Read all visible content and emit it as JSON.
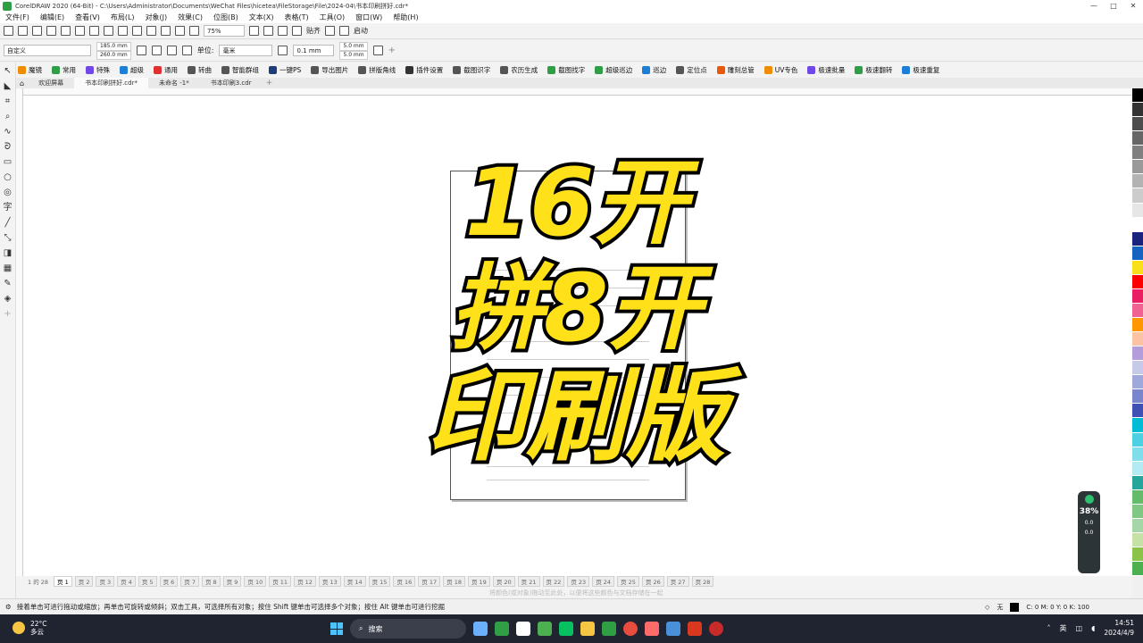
{
  "app": {
    "title": "CorelDRAW 2020 (64-Bit) - C:\\Users\\Administrator\\Documents\\WeChat Files\\hicetea\\FileStorage\\File\\2024-04\\书本印刷拼好.cdr*",
    "window_controls": [
      "—",
      "□",
      "✕"
    ]
  },
  "menu": [
    "文件(F)",
    "编辑(E)",
    "查看(V)",
    "布局(L)",
    "对象(J)",
    "效果(C)",
    "位图(B)",
    "文本(X)",
    "表格(T)",
    "工具(O)",
    "窗口(W)",
    "帮助(H)"
  ],
  "toolbar1": {
    "zoom": "75%",
    "snap_label": "贴齐",
    "launch_label": "启动"
  },
  "toolbar2": {
    "preset": "自定义",
    "width": "185.0 mm",
    "height": "260.0 mm",
    "units_label": "单位:",
    "units": "毫米",
    "nudge": "0.1 mm",
    "dup_x": "5.0 mm",
    "dup_y": "5.0 mm"
  },
  "plugins": [
    {
      "label": "魔镜",
      "color": "#f08c00"
    },
    {
      "label": "常用",
      "color": "#2f9e44"
    },
    {
      "label": "特殊",
      "color": "#7048e8"
    },
    {
      "label": "超级",
      "color": "#1c7ed6"
    },
    {
      "label": "通用",
      "color": "#e03131"
    },
    {
      "label": "转曲",
      "color": "#555555"
    },
    {
      "label": "智能群组",
      "color": "#555555"
    },
    {
      "label": "一键PS",
      "color": "#1c3d7a"
    },
    {
      "label": "导出图片",
      "color": "#555555"
    },
    {
      "label": "拼版角线",
      "color": "#555555"
    },
    {
      "label": "插件设置",
      "color": "#333333"
    },
    {
      "label": "截图识字",
      "color": "#555555"
    },
    {
      "label": "农历生成",
      "color": "#555555"
    },
    {
      "label": "截图找字",
      "color": "#2f9e44"
    },
    {
      "label": "超级巡边",
      "color": "#2f9e44"
    },
    {
      "label": "巡边",
      "color": "#1c7ed6"
    },
    {
      "label": "定位点",
      "color": "#555555"
    },
    {
      "label": "雕刻总管",
      "color": "#e8590c"
    },
    {
      "label": "UV专色",
      "color": "#f08c00"
    },
    {
      "label": "极速批量",
      "color": "#7048e8"
    },
    {
      "label": "极速翻转",
      "color": "#2f9e44"
    },
    {
      "label": "极速重复",
      "color": "#1c7ed6"
    }
  ],
  "doc_tabs": [
    {
      "label": "欢迎屏幕",
      "active": false
    },
    {
      "label": "书本印刷拼好.cdr*",
      "active": true
    },
    {
      "label": "未命名 -1*",
      "active": false
    },
    {
      "label": "书本印刷3.cdr",
      "active": false
    }
  ],
  "overlay": {
    "line1": "16开",
    "line2": "拼8开",
    "line3": "印刷版",
    "fill_color": "#ffe11a",
    "stroke_color": "#000000"
  },
  "pages": [
    "页 1",
    "页 2",
    "页 3",
    "页 4",
    "页 5",
    "页 6",
    "页 7",
    "页 8",
    "页 9",
    "页 10",
    "页 11",
    "页 12",
    "页 13",
    "页 14",
    "页 15",
    "页 16",
    "页 17",
    "页 18",
    "页 19",
    "页 20",
    "页 21",
    "页 22",
    "页 23",
    "页 24",
    "页 25",
    "页 26",
    "页 27",
    "页 28"
  ],
  "page_nav": {
    "counter": "1 的 28"
  },
  "color_hint": "将颜色(或对象)拖动至此处，以便将这些颜色与文档存储在一起",
  "status": {
    "message": "接着单击可进行拖动或缩放；再单击可旋转或倾斜；双击工具，可选择所有对象；按住 Shift 键单击可选择多个对象；按住 Alt 键单击可进行挖掘",
    "fill": "无",
    "cmyk": "C: 0 M: 0 Y: 0 K: 100"
  },
  "perf_widget": {
    "percent": "38%",
    "up": "0.0",
    "down": "0.0"
  },
  "palette": [
    "#000000",
    "#333333",
    "#4d4d4d",
    "#666666",
    "#808080",
    "#999999",
    "#b3b3b3",
    "#cccccc",
    "#e6e6e6",
    "#ffffff",
    "#1a237e",
    "#1565c0",
    "#f9e01b",
    "#ff0000",
    "#e91e63",
    "#f06292",
    "#ff9800",
    "#fbc2a4",
    "#b39ddb",
    "#c5cae9",
    "#9fa8da",
    "#7986cb",
    "#3f51b5",
    "#00bcd4",
    "#4dd0e1",
    "#80deea",
    "#b2ebf2",
    "#26a69a",
    "#66bb6a",
    "#81c784",
    "#a5d6a7",
    "#c5e1a5",
    "#8bc34a",
    "#4caf50"
  ],
  "taskbar": {
    "temp": "22°C",
    "weather": "多云",
    "search": "搜索",
    "lang": "英",
    "time": "14:51",
    "date": "2024/4/9"
  }
}
